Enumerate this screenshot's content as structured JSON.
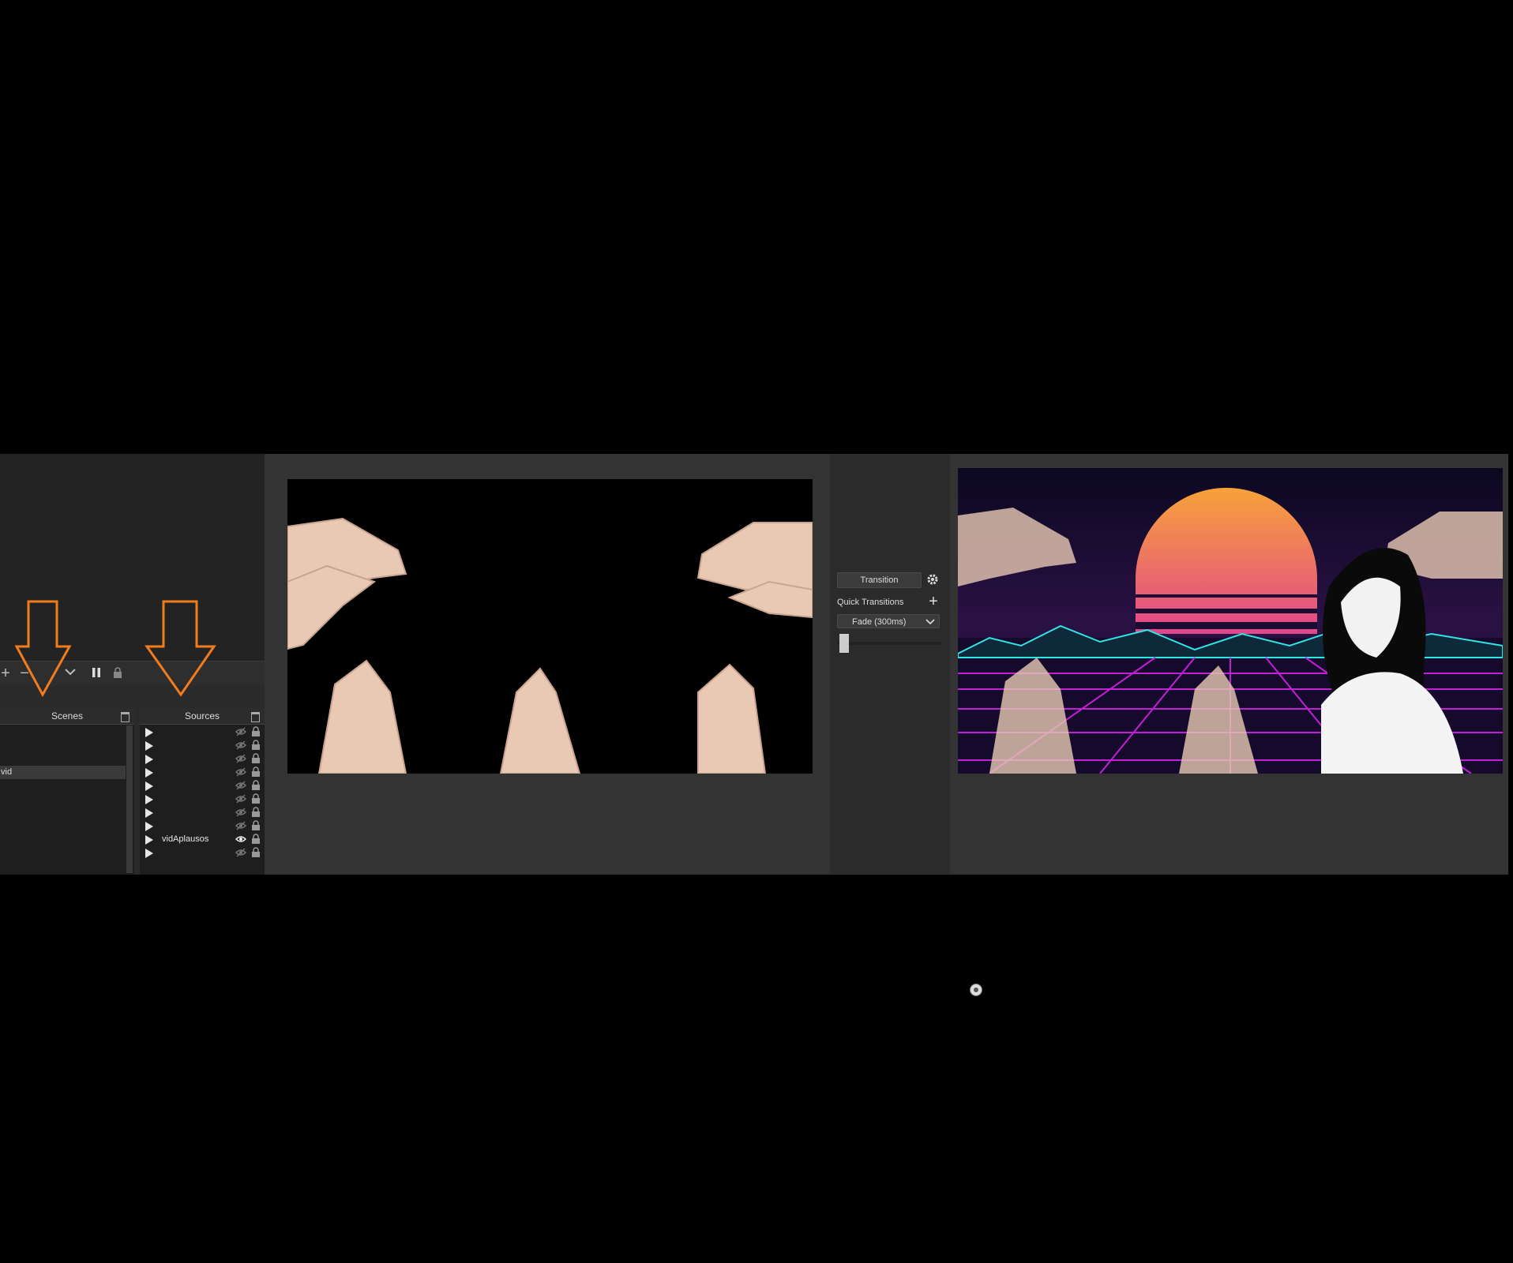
{
  "docks": {
    "scenes": {
      "title": "Scenes",
      "selected_scene": "vid"
    },
    "sources": {
      "title": "Sources",
      "items": [
        {
          "name": "",
          "visible": false
        },
        {
          "name": "",
          "visible": false
        },
        {
          "name": "",
          "visible": false
        },
        {
          "name": "",
          "visible": false
        },
        {
          "name": "",
          "visible": false
        },
        {
          "name": "",
          "visible": false
        },
        {
          "name": "",
          "visible": false
        },
        {
          "name": "",
          "visible": false
        },
        {
          "name": "vidAplausos",
          "visible": true
        },
        {
          "name": "",
          "visible": false
        }
      ]
    }
  },
  "toolbar": {
    "add_icon": "plus-icon",
    "remove_icon": "minus-icon",
    "down_icon": "chevron-down-icon",
    "pause_icon": "pause-icon",
    "lock_icon": "lock-icon"
  },
  "transitions": {
    "transition_button": "Transition",
    "quick_transitions_label": "Quick Transitions",
    "selected": "Fade (300ms)",
    "tbar_value": 0
  },
  "annotations": {
    "arrow_color": "#f07c1e",
    "arrow_icon": "down-arrow-icon"
  },
  "colors": {
    "panel": "#333333",
    "dock": "#1e1e1e",
    "sun_top": "#f7a23a",
    "sun_bottom": "#e2468c",
    "grid": "#c21fd6",
    "mountains": "#2fe6e6"
  }
}
